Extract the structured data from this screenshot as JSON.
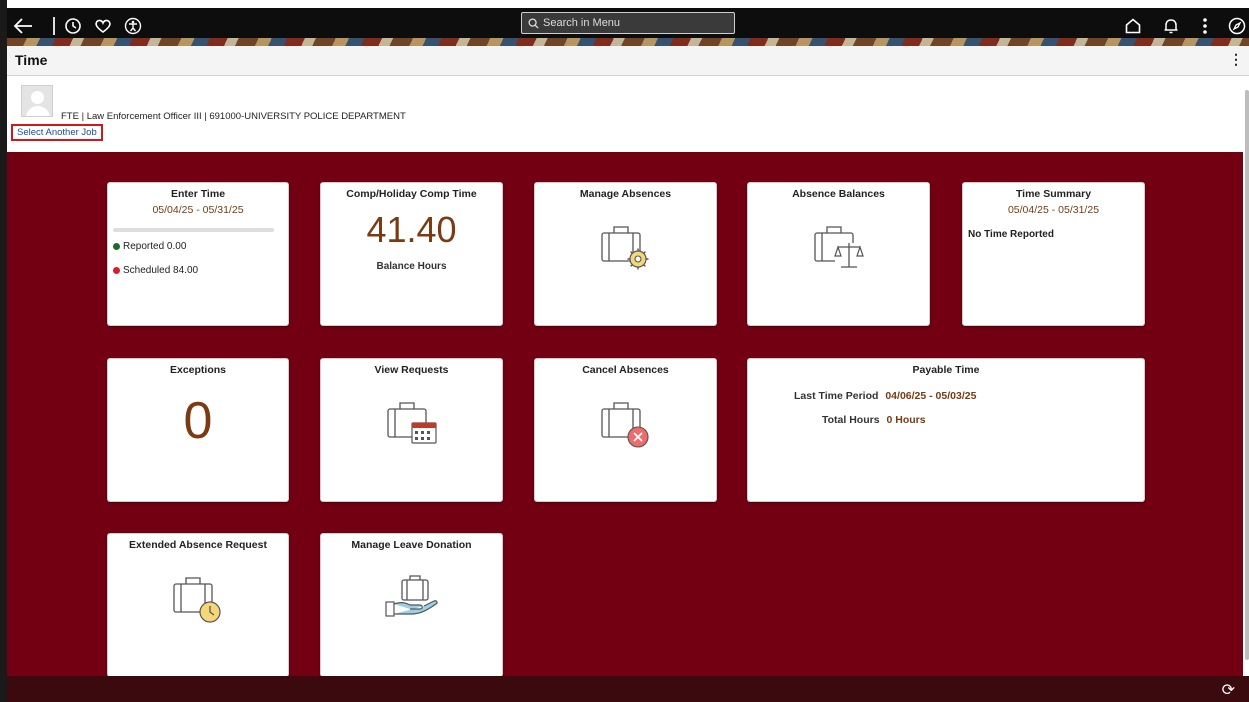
{
  "nav": {
    "search_placeholder": "Search in Menu"
  },
  "header": {
    "title": "Time"
  },
  "job": {
    "description": "FTE | Law Enforcement Officer III | 691000-UNIVERSITY POLICE DEPARTMENT",
    "select_link": "Select Another Job"
  },
  "colors": {
    "brand_maroon": "#720012",
    "accent_brown": "#7a3b12",
    "reported_green": "#1c6b2a",
    "scheduled_red": "#d81e2a"
  },
  "tiles": {
    "enter_time": {
      "title": "Enter Time",
      "period": "05/04/25 - 05/31/25",
      "reported": "Reported 0.00",
      "scheduled": "Scheduled 84.00",
      "reported_fraction": 0.0
    },
    "comp_time": {
      "title": "Comp/Holiday Comp Time",
      "value": "41.40",
      "label": "Balance Hours"
    },
    "manage_absences": {
      "title": "Manage Absences",
      "icon": "briefcase-gear-icon"
    },
    "absence_balances": {
      "title": "Absence Balances",
      "icon": "briefcase-scale-icon"
    },
    "time_summary": {
      "title": "Time Summary",
      "period": "05/04/25 - 05/31/25",
      "status": "No Time Reported"
    },
    "exceptions": {
      "title": "Exceptions",
      "value": "0"
    },
    "view_requests": {
      "title": "View Requests",
      "icon": "briefcase-calendar-icon"
    },
    "cancel_absences": {
      "title": "Cancel Absences",
      "icon": "briefcase-cancel-icon"
    },
    "payable_time": {
      "title": "Payable Time",
      "last_period_label": "Last Time Period",
      "last_period_value": "04/06/25 - 05/03/25",
      "total_hours_label": "Total Hours",
      "total_hours_value": "0 Hours"
    },
    "extended_absence": {
      "title": "Extended Absence Request",
      "icon": "briefcase-clock-icon"
    },
    "leave_donation": {
      "title": "Manage Leave Donation",
      "icon": "briefcase-hand-icon"
    }
  }
}
